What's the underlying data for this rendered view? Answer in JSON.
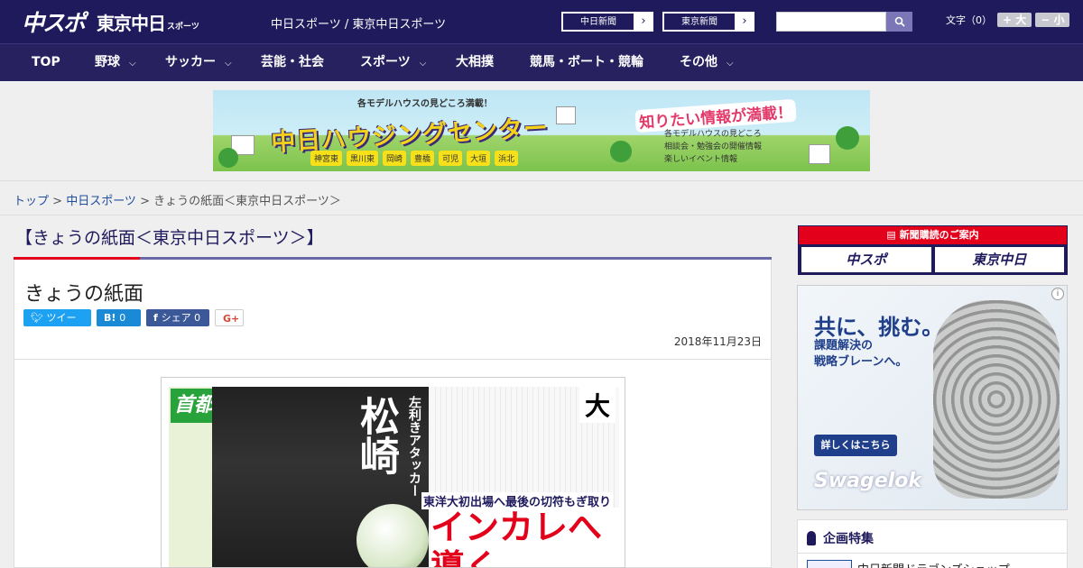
{
  "header": {
    "logo_main": "中スポ",
    "logo_tokyo": "東京中日",
    "logo_sports": "スポーツ",
    "site_links": "中日スポーツ / 東京中日スポーツ",
    "paper_buttons": [
      {
        "label": "中日新聞"
      },
      {
        "label": "東京新聞"
      }
    ],
    "search_placeholder": "",
    "font_size_label": "文字（0）",
    "font_larger": "+ 大",
    "font_smaller": "− 小"
  },
  "nav": {
    "items": [
      {
        "label": "TOP",
        "has_menu": false
      },
      {
        "label": "野球",
        "has_menu": true
      },
      {
        "label": "サッカー",
        "has_menu": true
      },
      {
        "label": "芸能・社会",
        "has_menu": false
      },
      {
        "label": "スポーツ",
        "has_menu": true
      },
      {
        "label": "大相撲",
        "has_menu": false
      },
      {
        "label": "競馬・ボート・競輪",
        "has_menu": false
      },
      {
        "label": "その他",
        "has_menu": true
      }
    ]
  },
  "banner": {
    "top_text": "各モデルハウスの見どころ満載！",
    "title": "中日ハウジングセンター",
    "right_title": "知りたい情報が満載！",
    "list": [
      "各モデルハウスの見どころ",
      "相談会・勉強会の開催情報",
      "楽しいイベント情報"
    ],
    "cities": [
      "神宮東",
      "黒川東",
      "岡崎",
      "豊橋",
      "可児",
      "大垣",
      "浜北"
    ]
  },
  "breadcrumb": {
    "top": "トップ",
    "section": "中日スポーツ",
    "current": "きょうの紙面＜東京中日スポーツ＞",
    "sep": " > "
  },
  "main": {
    "page_heading": "【きょうの紙面＜東京中日スポーツ＞】",
    "article_title": "きょうの紙面",
    "share": {
      "tweet": "ツイート",
      "hatena_count": "0",
      "facebook": "シェア 0",
      "gplus": "G+"
    },
    "date": "2018年11月23日",
    "paper": {
      "logo": "首都スポ",
      "kanji": "松崎",
      "sub": "左利きアタッカー",
      "dai": "大",
      "lead": "東洋大初出場へ最後の切符もぎ取り",
      "headline": "インカレへ導く"
    }
  },
  "sidebar": {
    "subscription_head": "新聞購読のご案内",
    "sub_logos": [
      "中スポ",
      "東京中日"
    ],
    "ad": {
      "title": "共に、挑む。",
      "sub1": "課題解決の",
      "sub2": "戦略ブレーンへ。",
      "button": "詳しくはこちら",
      "brand": "Swagelok"
    },
    "feature_head": "企画特集",
    "feature_item": "中日新聞ドラゴンズショップ"
  },
  "colors": {
    "header_bg": "#1f1a5c",
    "nav_bg": "#27215f",
    "accent_red": "#e2001a",
    "link": "#1f4d9e"
  }
}
